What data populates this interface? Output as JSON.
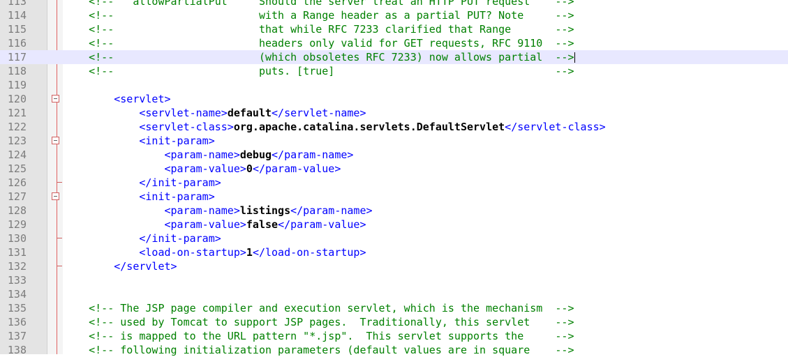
{
  "editor": {
    "lines": [
      {
        "num": "113",
        "segments": [
          {
            "t": "c",
            "v": "    <!--   allowPartialPut     Should the server treat an HTTP PUT request    -->"
          }
        ]
      },
      {
        "num": "114",
        "segments": [
          {
            "t": "c",
            "v": "    <!--                       with a Range header as a partial PUT? Note     -->"
          }
        ]
      },
      {
        "num": "115",
        "segments": [
          {
            "t": "c",
            "v": "    <!--                       that while RFC 7233 clarified that Range       -->"
          }
        ]
      },
      {
        "num": "116",
        "segments": [
          {
            "t": "c",
            "v": "    <!--                       headers only valid for GET requests, RFC 9110  -->"
          }
        ]
      },
      {
        "num": "117",
        "current": true,
        "segments": [
          {
            "t": "c",
            "v": "    <!--                       (which obsoletes RFC 7233) now allows partial  -->"
          }
        ]
      },
      {
        "num": "118",
        "segments": [
          {
            "t": "c",
            "v": "    <!--                       puts. [true]                                   -->"
          }
        ]
      },
      {
        "num": "119",
        "segments": []
      },
      {
        "num": "120",
        "fold": "open",
        "segments": [
          {
            "t": "p",
            "v": "        "
          },
          {
            "t": "g",
            "v": "<servlet>"
          }
        ]
      },
      {
        "num": "121",
        "segments": [
          {
            "t": "p",
            "v": "            "
          },
          {
            "t": "g",
            "v": "<servlet-name>"
          },
          {
            "t": "x",
            "v": "default"
          },
          {
            "t": "g",
            "v": "</servlet-name>"
          }
        ]
      },
      {
        "num": "122",
        "segments": [
          {
            "t": "p",
            "v": "            "
          },
          {
            "t": "g",
            "v": "<servlet-class>"
          },
          {
            "t": "x",
            "v": "org.apache.catalina.servlets.DefaultServlet"
          },
          {
            "t": "g",
            "v": "</servlet-class>"
          }
        ]
      },
      {
        "num": "123",
        "fold": "open",
        "segments": [
          {
            "t": "p",
            "v": "            "
          },
          {
            "t": "g",
            "v": "<init-param>"
          }
        ]
      },
      {
        "num": "124",
        "segments": [
          {
            "t": "p",
            "v": "                "
          },
          {
            "t": "g",
            "v": "<param-name>"
          },
          {
            "t": "x",
            "v": "debug"
          },
          {
            "t": "g",
            "v": "</param-name>"
          }
        ]
      },
      {
        "num": "125",
        "segments": [
          {
            "t": "p",
            "v": "                "
          },
          {
            "t": "g",
            "v": "<param-value>"
          },
          {
            "t": "x",
            "v": "0"
          },
          {
            "t": "g",
            "v": "</param-value>"
          }
        ]
      },
      {
        "num": "126",
        "fold": "end",
        "segments": [
          {
            "t": "p",
            "v": "            "
          },
          {
            "t": "g",
            "v": "</init-param>"
          }
        ]
      },
      {
        "num": "127",
        "fold": "open",
        "segments": [
          {
            "t": "p",
            "v": "            "
          },
          {
            "t": "g",
            "v": "<init-param>"
          }
        ]
      },
      {
        "num": "128",
        "segments": [
          {
            "t": "p",
            "v": "                "
          },
          {
            "t": "g",
            "v": "<param-name>"
          },
          {
            "t": "x",
            "v": "listings"
          },
          {
            "t": "g",
            "v": "</param-name>"
          }
        ]
      },
      {
        "num": "129",
        "segments": [
          {
            "t": "p",
            "v": "                "
          },
          {
            "t": "g",
            "v": "<param-value>"
          },
          {
            "t": "x",
            "v": "false"
          },
          {
            "t": "g",
            "v": "</param-value>"
          }
        ]
      },
      {
        "num": "130",
        "fold": "end",
        "segments": [
          {
            "t": "p",
            "v": "            "
          },
          {
            "t": "g",
            "v": "</init-param>"
          }
        ]
      },
      {
        "num": "131",
        "segments": [
          {
            "t": "p",
            "v": "            "
          },
          {
            "t": "g",
            "v": "<load-on-startup>"
          },
          {
            "t": "x",
            "v": "1"
          },
          {
            "t": "g",
            "v": "</load-on-startup>"
          }
        ]
      },
      {
        "num": "132",
        "fold": "end",
        "segments": [
          {
            "t": "p",
            "v": "        "
          },
          {
            "t": "g",
            "v": "</servlet>"
          }
        ]
      },
      {
        "num": "133",
        "segments": []
      },
      {
        "num": "134",
        "segments": []
      },
      {
        "num": "135",
        "segments": [
          {
            "t": "c",
            "v": "    <!-- The JSP page compiler and execution servlet, which is the mechanism  -->"
          }
        ]
      },
      {
        "num": "136",
        "segments": [
          {
            "t": "c",
            "v": "    <!-- used by Tomcat to support JSP pages.  Traditionally, this servlet    -->"
          }
        ]
      },
      {
        "num": "137",
        "segments": [
          {
            "t": "c",
            "v": "    <!-- is mapped to the URL pattern \"*.jsp\".  This servlet supports the     -->"
          }
        ]
      },
      {
        "num": "138",
        "segments": [
          {
            "t": "c",
            "v": "    <!-- following initialization parameters (default values are in square    -->"
          }
        ]
      }
    ],
    "colors": {
      "comment": "#008000",
      "tag": "#0000ff",
      "text": "#000000",
      "line_number": "#7c7c7c",
      "current_line": "#e8e8ff",
      "fold_marker": "#d06060"
    },
    "icons": {
      "fold_open": "fold-minus-icon",
      "fold_end": "fold-end-icon"
    }
  }
}
